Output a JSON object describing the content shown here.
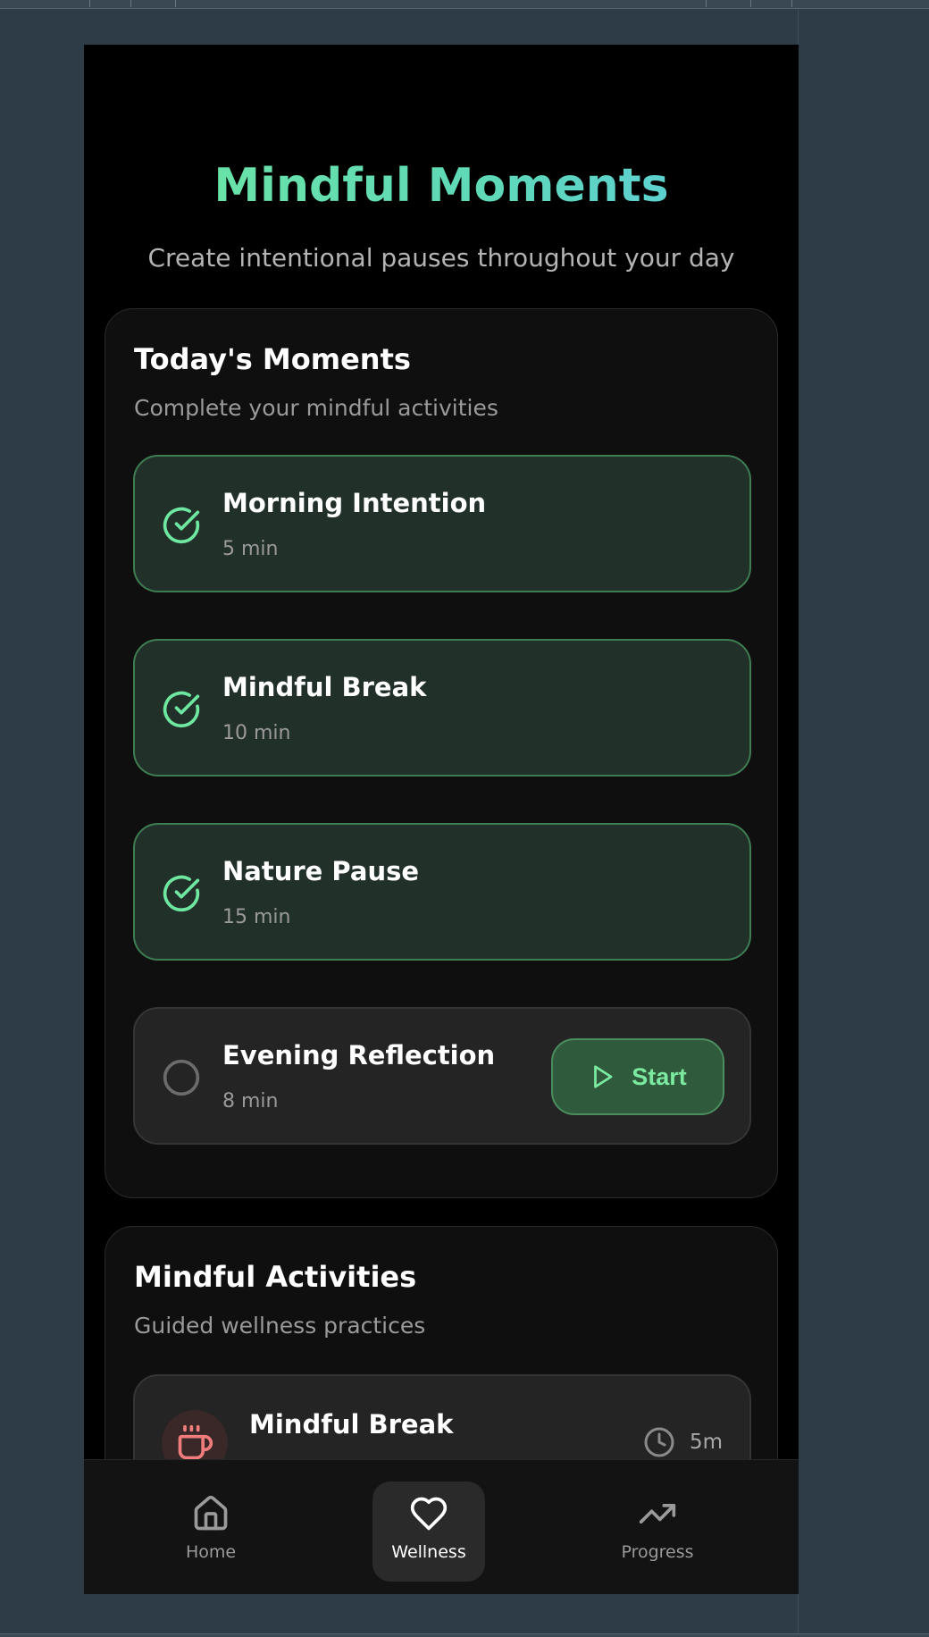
{
  "header": {
    "title": "Mindful Moments",
    "subtitle": "Create intentional pauses throughout your day"
  },
  "todays_moments": {
    "title": "Today's Moments",
    "subtitle": "Complete your mindful activities",
    "items": [
      {
        "name": "Morning Intention",
        "duration": "5 min",
        "completed": true
      },
      {
        "name": "Mindful Break",
        "duration": "10 min",
        "completed": true
      },
      {
        "name": "Nature Pause",
        "duration": "15 min",
        "completed": true
      },
      {
        "name": "Evening Reflection",
        "duration": "8 min",
        "completed": false,
        "action_label": "Start"
      }
    ]
  },
  "activities": {
    "title": "Mindful Activities",
    "subtitle": "Guided wellness practices",
    "items": [
      {
        "name": "Mindful Break",
        "duration": "5m",
        "icon": "coffee-cup-icon"
      }
    ]
  },
  "nav": {
    "items": [
      {
        "label": "Home",
        "icon": "home-icon",
        "active": false
      },
      {
        "label": "Wellness",
        "icon": "heart-icon",
        "active": true
      },
      {
        "label": "Progress",
        "icon": "trending-up-icon",
        "active": false
      }
    ]
  },
  "colors": {
    "accent_green": "#6ee7a0",
    "accent_teal": "#5ccbe0",
    "completed_border": "#3e7d52",
    "activity_icon": "#f07c7c"
  }
}
